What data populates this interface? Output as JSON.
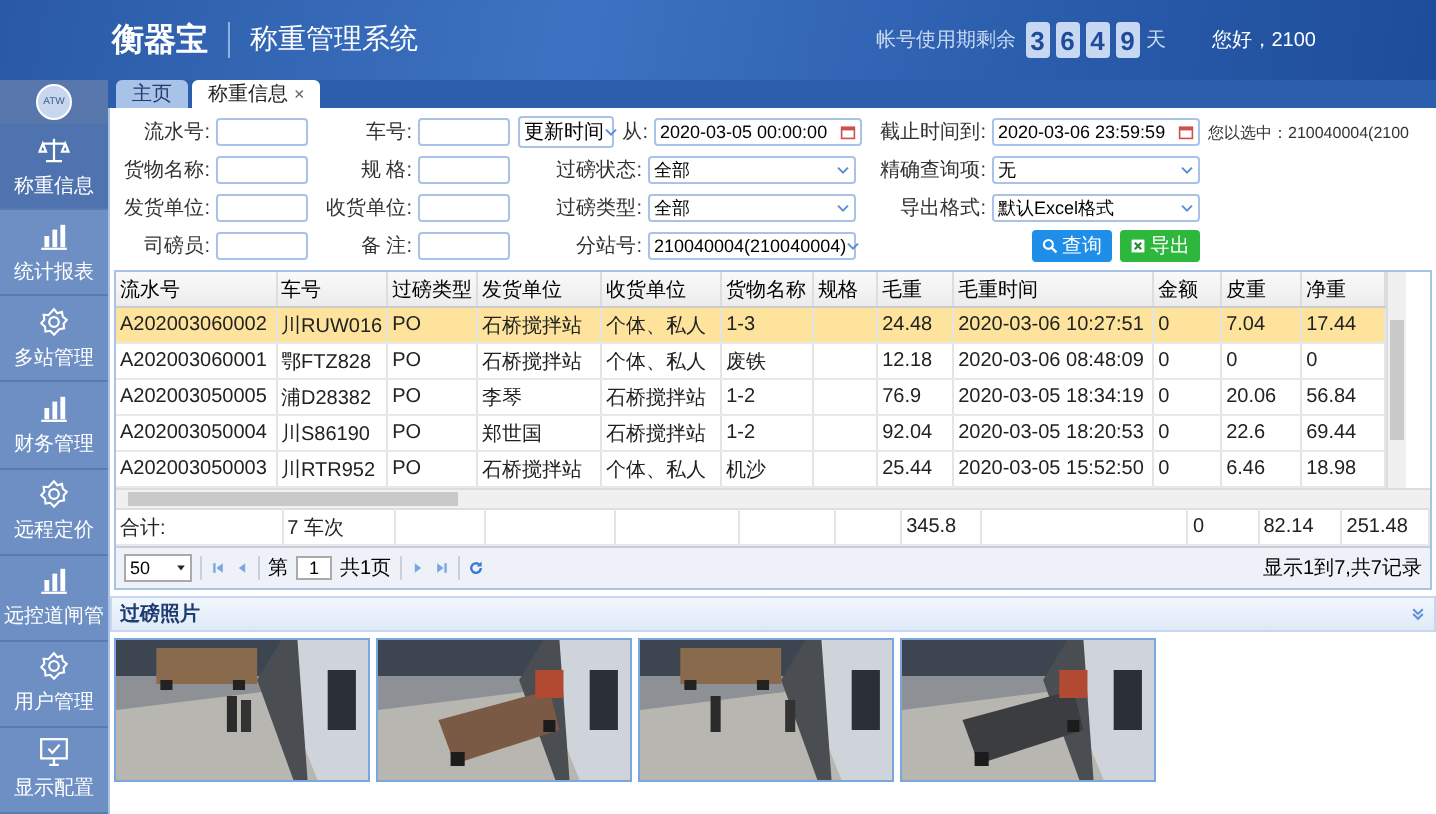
{
  "header": {
    "logo": "衡器宝",
    "system_title": "称重管理系统",
    "remaining_label": "帐号使用期剩余",
    "remaining_digits": [
      "3",
      "6",
      "4",
      "9"
    ],
    "remaining_unit": "天",
    "greeting": "您好，2100"
  },
  "sidebar": {
    "avatar": "ATW",
    "items": [
      {
        "label": "称重信息",
        "selected": true
      },
      {
        "label": "统计报表",
        "selected": false
      },
      {
        "label": "多站管理",
        "selected": false
      },
      {
        "label": "财务管理",
        "selected": false
      },
      {
        "label": "远程定价",
        "selected": false
      },
      {
        "label": "远控道闸管",
        "selected": false
      },
      {
        "label": "用户管理",
        "selected": false
      },
      {
        "label": "显示配置",
        "selected": false
      }
    ]
  },
  "tabs": [
    {
      "label": "主页",
      "selected": false
    },
    {
      "label": "称重信息",
      "selected": true,
      "close": "×"
    }
  ],
  "filters": {
    "columns": [
      [
        {
          "kind": "text",
          "label": "流水号:"
        },
        {
          "kind": "text",
          "label": "货物名称:"
        },
        {
          "kind": "text",
          "label": "发货单位:"
        },
        {
          "kind": "text",
          "label": "司磅员:"
        }
      ],
      [
        {
          "kind": "text",
          "label": "车号:"
        },
        {
          "kind": "text",
          "label": "规 格:"
        },
        {
          "kind": "text",
          "label": "收货单位:"
        },
        {
          "kind": "text",
          "label": "备 注:"
        }
      ],
      [
        {
          "kind": "date",
          "selector": "更新时间",
          "label": "从:",
          "value": "2020-03-05 00:00:00"
        },
        {
          "kind": "select",
          "label": "过磅状态:",
          "value": "全部"
        },
        {
          "kind": "select",
          "label": "过磅类型:",
          "value": "全部"
        },
        {
          "kind": "select",
          "label": "分站号:",
          "value": "210040004(210040004)"
        }
      ],
      [
        {
          "kind": "date",
          "label": "截止时间到:",
          "value": "2020-03-06 23:59:59"
        },
        {
          "kind": "select",
          "label": "精确查询项:",
          "value": "无"
        },
        {
          "kind": "select",
          "label": "导出格式:",
          "value": "默认Excel格式"
        }
      ]
    ],
    "buttons": [
      {
        "kind": "search",
        "label": "查询"
      },
      {
        "kind": "export",
        "label": "导出"
      }
    ],
    "selection_info": "您以选中：210040004(2100"
  },
  "table": {
    "columns": [
      "流水号",
      "车号",
      "过磅类型",
      "发货单位",
      "收货单位",
      "货物名称",
      "规格",
      "毛重",
      "毛重时间",
      "金额",
      "皮重",
      "净重"
    ],
    "rows": [
      {
        "selected": true,
        "cells": [
          "A202003060002",
          "川RUW016",
          "PO",
          "石桥搅拌站",
          "个体、私人",
          "1-3",
          null,
          "24.48",
          "2020-03-06 10:27:51",
          "0",
          "7.04",
          "17.44"
        ]
      },
      {
        "selected": false,
        "cells": [
          "A202003060001",
          "鄂FTZ828",
          "PO",
          "石桥搅拌站",
          "个体、私人",
          "废铁",
          null,
          "12.18",
          "2020-03-06 08:48:09",
          "0",
          "0",
          "0"
        ]
      },
      {
        "selected": false,
        "cells": [
          "A202003050005",
          "浦D28382",
          "PO",
          "李琴",
          "石桥搅拌站",
          "1-2",
          null,
          "76.9",
          "2020-03-05 18:34:19",
          "0",
          "20.06",
          "56.84"
        ]
      },
      {
        "selected": false,
        "cells": [
          "A202003050004",
          "川S86190",
          "PO",
          "郑世国",
          "石桥搅拌站",
          "1-2",
          null,
          "92.04",
          "2020-03-05 18:20:53",
          "0",
          "22.6",
          "69.44"
        ]
      },
      {
        "selected": false,
        "cells": [
          "A202003050003",
          "川RTR952",
          "PO",
          "石桥搅拌站",
          "个体、私人",
          "机沙",
          null,
          "25.44",
          "2020-03-05 15:52:50",
          "0",
          "6.46",
          "18.98"
        ]
      }
    ],
    "totals": {
      "label": "合计:",
      "trips": "7 车次",
      "gross": "345.8",
      "amount": "0",
      "tare": "82.14",
      "net": "251.48"
    }
  },
  "pager": {
    "page_size": "50",
    "before_page": "第",
    "page": "1",
    "after_page": "共1页",
    "summary": "显示1到7,共7记录"
  },
  "photos": {
    "title": "过磅照片"
  }
}
